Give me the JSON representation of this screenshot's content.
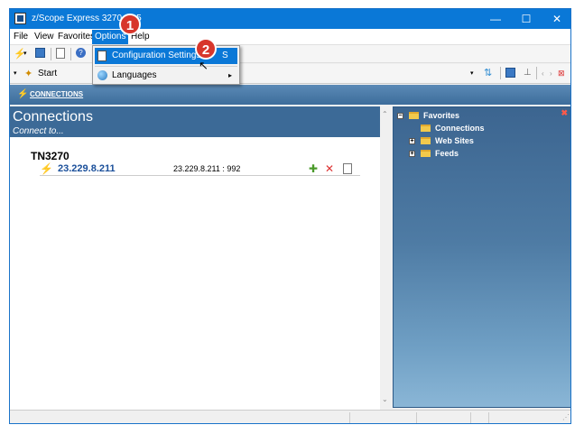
{
  "window": {
    "title": "z/Scope Express 3270 v6.5",
    "controls": {
      "minimize": "—",
      "maximize": "☐",
      "close": "✕"
    }
  },
  "menubar": {
    "items": [
      "File",
      "View",
      "Favorites",
      "Options",
      "Help"
    ]
  },
  "options_menu": {
    "items": [
      {
        "label": "Configuration Settings",
        "icon": "settings-doc-icon"
      },
      {
        "label": "Languages",
        "icon": "globe-icon"
      }
    ],
    "partial_text": "S"
  },
  "toolbar": {
    "start_label": "Start"
  },
  "nav": {
    "link": "CONNECTIONS"
  },
  "connections": {
    "title": "Connections",
    "subtitle": "Connect to...",
    "group": "TN3270",
    "rows": [
      {
        "name": "23.229.8.211",
        "address": "23.229.8.211 : 992"
      }
    ]
  },
  "favorites": {
    "root": "Favorites",
    "children": [
      "Connections",
      "Web Sites",
      "Feeds"
    ]
  },
  "callouts": [
    "1",
    "2"
  ],
  "colors": {
    "titlebar": "#0a78d7",
    "pane": "#3c6a97",
    "badge": "#d7362b",
    "link": "#1a4f9a"
  }
}
